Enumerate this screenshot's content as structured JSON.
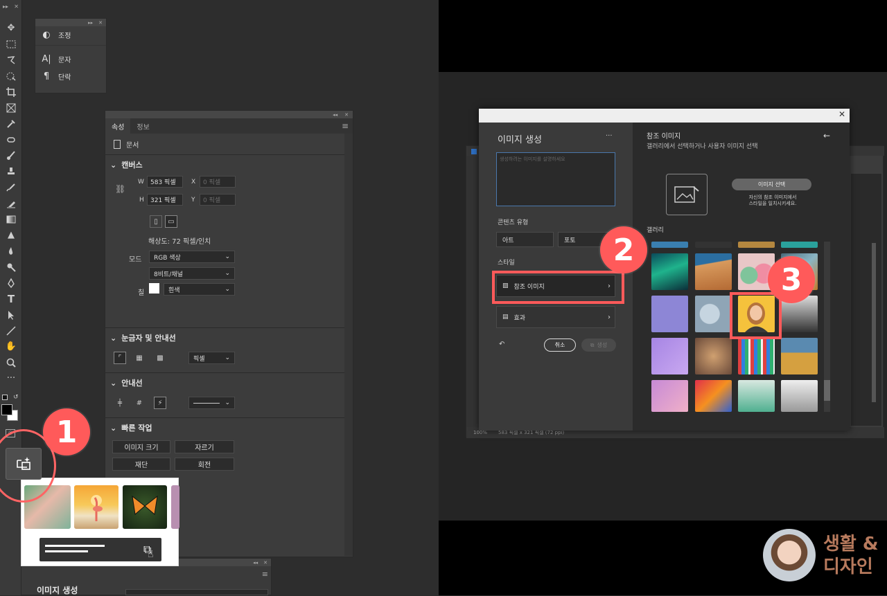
{
  "panels": {
    "adjust": {
      "items": [
        {
          "icon": "adjust-icon",
          "label": "조정"
        },
        {
          "icon": "text-icon",
          "label": "문자"
        },
        {
          "icon": "paragraph-icon",
          "label": "단락"
        }
      ]
    }
  },
  "props": {
    "tabs": [
      "속성",
      "정보"
    ],
    "doc_label": "문서",
    "canvas": {
      "title": "캔버스",
      "w_label": "W",
      "w_value": "583 픽셀",
      "h_label": "H",
      "h_value": "321 픽셀",
      "x_label": "X",
      "x_placeholder": "0 픽셀",
      "y_label": "Y",
      "y_placeholder": "0 픽셀",
      "resolution": "해상도: 72 픽셀/인치",
      "mode_label": "모드",
      "mode": "RGB 색상",
      "depth": "8비트/채널",
      "fill_label": "칠",
      "fill": "흰색"
    },
    "rulers": {
      "title": "눈금자 및 안내선",
      "unit": "픽셀"
    },
    "guides": {
      "title": "안내선"
    },
    "quick": {
      "title": "빠른 작업",
      "buttons": [
        "이미지 크기",
        "자르기",
        "재단",
        "회전"
      ]
    }
  },
  "lower_panel": {
    "title": "이미지 생성"
  },
  "dialog": {
    "title": "이미지 생성",
    "more": "···",
    "prompt_placeholder": "생성하려는 이미지를 설명하세요",
    "content_type_label": "콘텐츠 유형",
    "content_types": [
      "아트",
      "포토"
    ],
    "style_label": "스타일",
    "ref_image": "참조 이미지",
    "effects": "효과",
    "cancel": "취소",
    "generate": "생성",
    "right": {
      "title": "참조 이미지",
      "subtitle": "갤러리에서 선택하거나 사용자 이미지 선택",
      "select_button": "이미지 선택",
      "hint_line1": "자신의 참조 이미지에서",
      "hint_line2": "스타일을 일치시키세요.",
      "gallery_label": "갤러리"
    },
    "status": "100%",
    "status_dims": "583 픽셀 x 321 픽셀 (72 ppi)"
  },
  "callouts": [
    "1",
    "2",
    "3"
  ],
  "brand": {
    "line1": "생활 &",
    "line2": "디자인"
  },
  "colors": {
    "accent": "#ff5a5a",
    "brand": "#b77a5d"
  }
}
